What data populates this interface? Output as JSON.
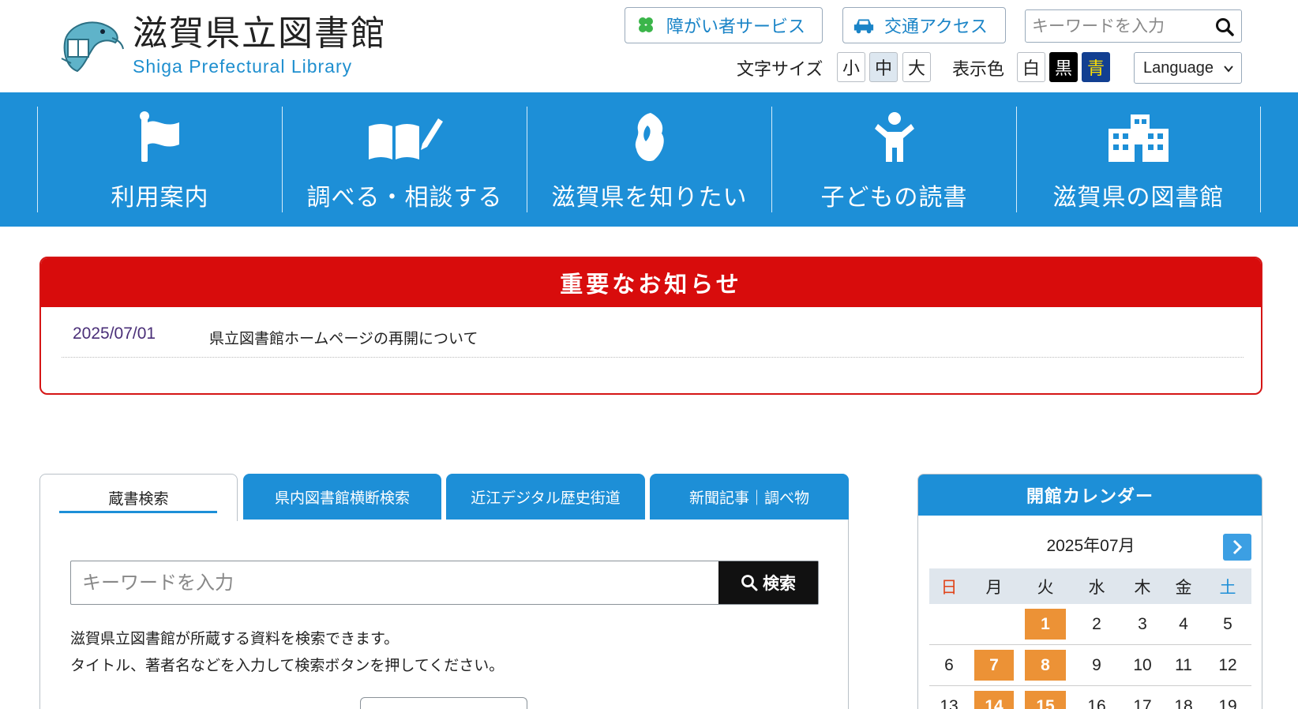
{
  "header": {
    "title": "滋賀県立図書館",
    "subtitle": "Shiga Prefectural Library",
    "disability_service": "障がい者サービス",
    "access": "交通アクセス",
    "search_placeholder": "キーワードを入力",
    "font_size_label": "文字サイズ",
    "font_sizes": [
      "小",
      "中",
      "大"
    ],
    "display_color_label": "表示色",
    "colors": [
      "白",
      "黒",
      "青"
    ],
    "language": "Language"
  },
  "nav": [
    {
      "label": "利用案内",
      "icon": "flag-icon"
    },
    {
      "label": "調べる・相談する",
      "icon": "book-pencil-icon"
    },
    {
      "label": "滋賀県を知りたい",
      "icon": "shiga-map-icon"
    },
    {
      "label": "子どもの読書",
      "icon": "child-icon"
    },
    {
      "label": "滋賀県の図書館",
      "icon": "building-icon"
    }
  ],
  "notice": {
    "heading": "重要なお知らせ",
    "items": [
      {
        "date": "2025/07/01",
        "title": "県立図書館ホームページの再開について"
      }
    ]
  },
  "search": {
    "tabs": [
      "蔵書検索",
      "県内図書館横断検索",
      "近江デジタル歴史街道",
      "新聞記事｜調べ物"
    ],
    "placeholder": "キーワードを入力",
    "button": "検索",
    "desc1": "滋賀県立図書館が所蔵する資料を検索できます。",
    "desc2": "タイトル、著者名などを入力して検索ボタンを押してください。"
  },
  "calendar": {
    "heading": "開館カレンダー",
    "month": "2025年07月",
    "dow": [
      "日",
      "月",
      "火",
      "水",
      "木",
      "金",
      "土"
    ],
    "rows": [
      [
        "",
        "",
        "1",
        "2",
        "3",
        "4",
        "5"
      ],
      [
        "6",
        "7",
        "8",
        "9",
        "10",
        "11",
        "12"
      ],
      [
        "13",
        "14",
        "15",
        "16",
        "17",
        "18",
        "19"
      ]
    ],
    "highlight": [
      "1",
      "7",
      "8",
      "14",
      "15"
    ],
    "colors": {
      "sunday": "#e0451b",
      "saturday": "#1d8fd7",
      "open": "#ec9236"
    }
  },
  "colors": {
    "brand_blue": "#1d8fd7",
    "notice_red": "#d80c0c"
  }
}
